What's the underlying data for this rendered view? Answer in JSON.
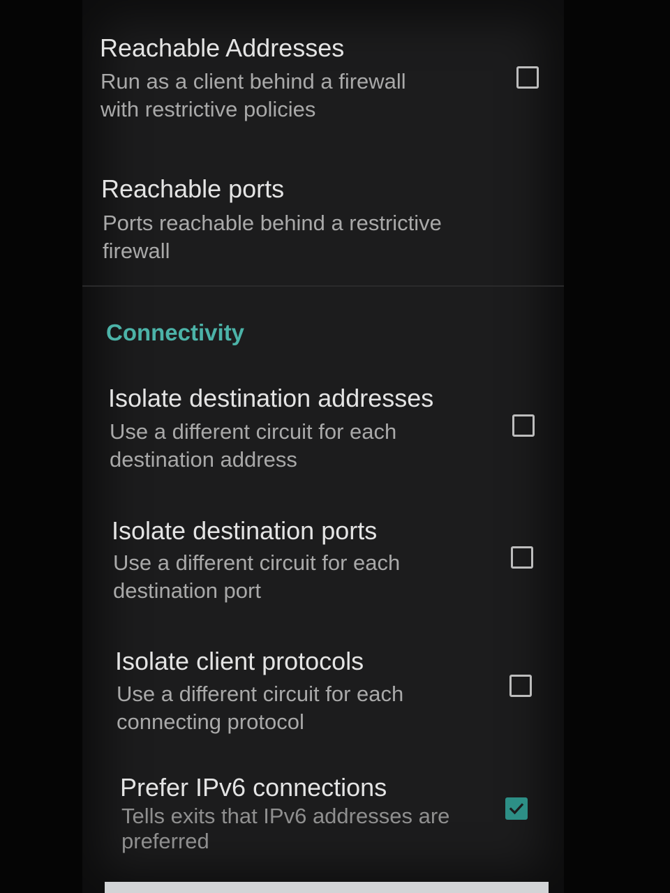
{
  "firewall_section": {
    "reachable_addresses": {
      "title": "Reachable Addresses",
      "summary_line1": "Run as a client behind a firewall",
      "summary_line2": "with restrictive policies",
      "checked": false
    },
    "reachable_ports": {
      "title": "Reachable ports",
      "summary_line1": "Ports reachable behind a restrictive",
      "summary_line2": "firewall"
    }
  },
  "connectivity": {
    "header": "Connectivity",
    "accent_color": "#4cb3a8",
    "items": [
      {
        "title": "Isolate destination addresses",
        "summary_line1": "Use a different circuit for each",
        "summary_line2": "destination address",
        "checked": false
      },
      {
        "title": "Isolate destination ports",
        "summary_line1": "Use a different circuit for each",
        "summary_line2": "destination port",
        "checked": false
      },
      {
        "title": "Isolate client protocols",
        "summary_line1": "Use a different circuit for each",
        "summary_line2": "connecting protocol",
        "checked": false
      },
      {
        "title": "Prefer IPv6 connections",
        "summary_line1": "Tells exits that IPv6 addresses are",
        "summary_line2": "preferred",
        "checked": true
      }
    ]
  }
}
